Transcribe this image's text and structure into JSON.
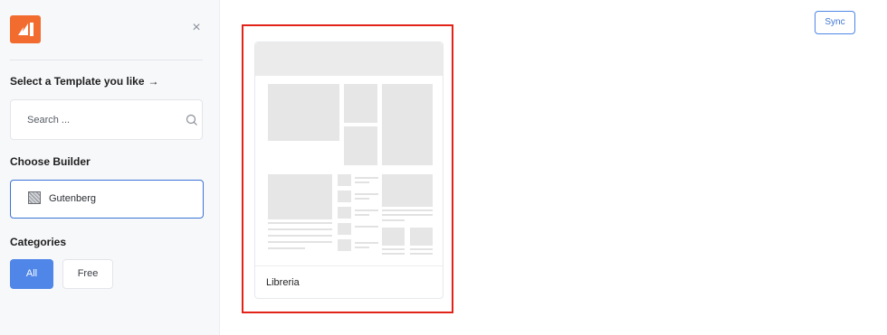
{
  "sidebar": {
    "template_heading": "Select a Template you like",
    "template_heading_arrow": "→",
    "close_glyph": "×",
    "search": {
      "placeholder": "Search ..."
    },
    "builder_heading": "Choose Builder",
    "builder": {
      "selected": "Gutenberg"
    },
    "categories_heading": "Categories",
    "categories": [
      {
        "label": "All",
        "active": true
      },
      {
        "label": "Free",
        "active": false
      }
    ]
  },
  "main": {
    "sync_label": "Sync",
    "templates": [
      {
        "name": "Libreria",
        "highlighted": true
      }
    ]
  },
  "colors": {
    "accent": "#4f86e8",
    "logo": "#f26c2f",
    "highlight": "#e2231a",
    "placeholder_gray": "#e6e6e6"
  },
  "icons": [
    "logo-icon",
    "close-icon",
    "search-icon",
    "gutenberg-icon",
    "arrow-right-icon"
  ]
}
